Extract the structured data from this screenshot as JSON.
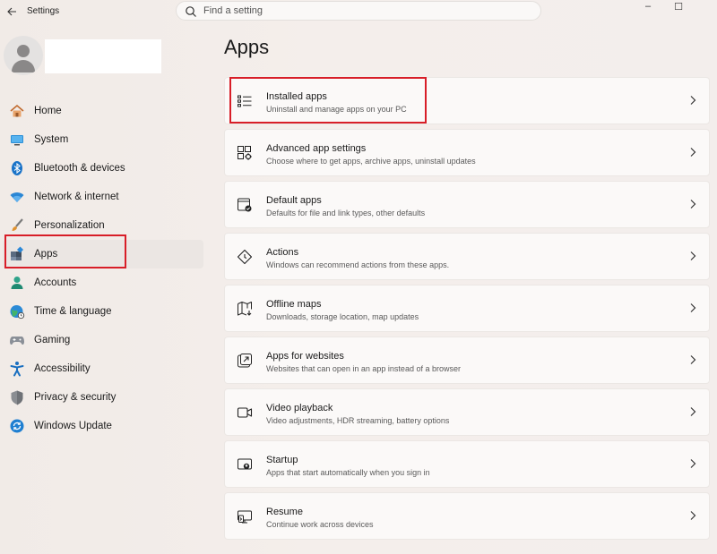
{
  "window": {
    "title": "Settings",
    "controls": {
      "minimize": "–",
      "maximize": "☐"
    }
  },
  "search": {
    "placeholder": "Find a setting"
  },
  "sidebar": {
    "items": [
      {
        "label": "Home",
        "icon": "home-icon"
      },
      {
        "label": "System",
        "icon": "system-icon"
      },
      {
        "label": "Bluetooth & devices",
        "icon": "bluetooth-icon"
      },
      {
        "label": "Network & internet",
        "icon": "wifi-icon"
      },
      {
        "label": "Personalization",
        "icon": "brush-icon"
      },
      {
        "label": "Apps",
        "icon": "apps-icon",
        "selected": true
      },
      {
        "label": "Accounts",
        "icon": "person-icon"
      },
      {
        "label": "Time & language",
        "icon": "globe-icon"
      },
      {
        "label": "Gaming",
        "icon": "gamepad-icon"
      },
      {
        "label": "Accessibility",
        "icon": "accessibility-icon"
      },
      {
        "label": "Privacy & security",
        "icon": "shield-icon"
      },
      {
        "label": "Windows Update",
        "icon": "update-icon"
      }
    ]
  },
  "main": {
    "title": "Apps",
    "cards": [
      {
        "title": "Installed apps",
        "desc": "Uninstall and manage apps on your PC",
        "icon": "list-icon"
      },
      {
        "title": "Advanced app settings",
        "desc": "Choose where to get apps, archive apps, uninstall updates",
        "icon": "app-settings-icon"
      },
      {
        "title": "Default apps",
        "desc": "Defaults for file and link types, other defaults",
        "icon": "default-apps-icon"
      },
      {
        "title": "Actions",
        "desc": "Windows can recommend actions from these apps.",
        "icon": "actions-icon"
      },
      {
        "title": "Offline maps",
        "desc": "Downloads, storage location, map updates",
        "icon": "map-icon"
      },
      {
        "title": "Apps for websites",
        "desc": "Websites that can open in an app instead of a browser",
        "icon": "open-in-app-icon"
      },
      {
        "title": "Video playback",
        "desc": "Video adjustments, HDR streaming, battery options",
        "icon": "video-icon"
      },
      {
        "title": "Startup",
        "desc": "Apps that start automatically when you sign in",
        "icon": "startup-icon"
      },
      {
        "title": "Resume",
        "desc": "Continue work across devices",
        "icon": "resume-icon"
      }
    ]
  },
  "colors": {
    "highlight": "#d81e28",
    "accent": "#0067c0"
  }
}
